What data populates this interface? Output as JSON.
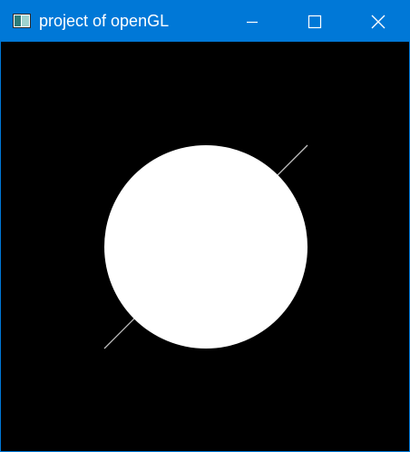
{
  "window": {
    "title": "project of openGL",
    "controls": {
      "minimize": "minimize-icon",
      "maximize": "maximize-icon",
      "close": "close-icon"
    }
  },
  "colors": {
    "titlebar": "#0078d7",
    "title_text": "#ffffff",
    "canvas_background": "#000000",
    "sphere": "#ffffff",
    "line": "#bfbfbf"
  },
  "canvas": {
    "objects": [
      "white-sphere",
      "diagonal-line"
    ]
  }
}
